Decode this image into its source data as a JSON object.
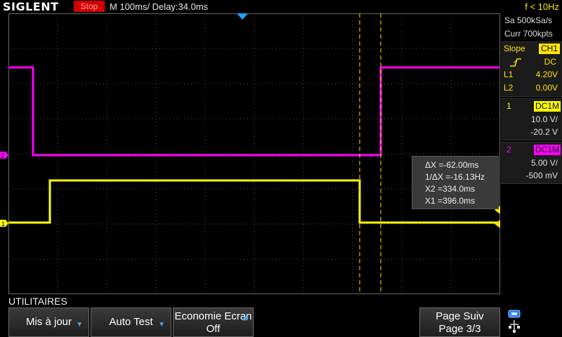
{
  "header": {
    "brand": "SIGLENT",
    "run_state": "Stop",
    "timebase": "M 100ms/  Delay:34.0ms",
    "frequency": "f < 10Hz"
  },
  "acquisition": {
    "sample_rate": "Sa 500kSa/s",
    "memory": "Curr 700kpts"
  },
  "trigger": {
    "label": "Slope",
    "source": "CH1",
    "coupling": "DC",
    "l1_label": "L1",
    "l1_value": "4.20V",
    "l2_label": "L2",
    "l2_value": "0.00V"
  },
  "channels": [
    {
      "number": "1",
      "coupling": "DC1M",
      "scale": "10.0 V/",
      "offset": "-20.2 V",
      "color": "#ffff00"
    },
    {
      "number": "2",
      "coupling": "DC1M",
      "scale": "5.00 V/",
      "offset": "-500 mV",
      "color": "#ff00ff"
    }
  ],
  "cursor_readout": {
    "delta_x": "ΔX =-62.00ms",
    "inv_delta_x": "1/ΔX =-16.13Hz",
    "x2": "X2 =334.0ms",
    "x1": "X1 =396.0ms"
  },
  "markers": {
    "ch2_marker": "2",
    "ch1_marker": "1"
  },
  "menu": {
    "title": "UTILITAIRES",
    "softkeys": {
      "updates": "Mis à jour",
      "auto_test": "Auto Test",
      "screen_saver_line1": "Economie Ecran",
      "screen_saver_line2": "Off",
      "next_page_line1": "Page Suiv",
      "next_page_line2": "Page 3/3"
    }
  },
  "icons": {
    "trigger_slope": "rising-edge-icon",
    "usb": "usb-icon",
    "softkey_arrow": "down-arrow-icon"
  }
}
